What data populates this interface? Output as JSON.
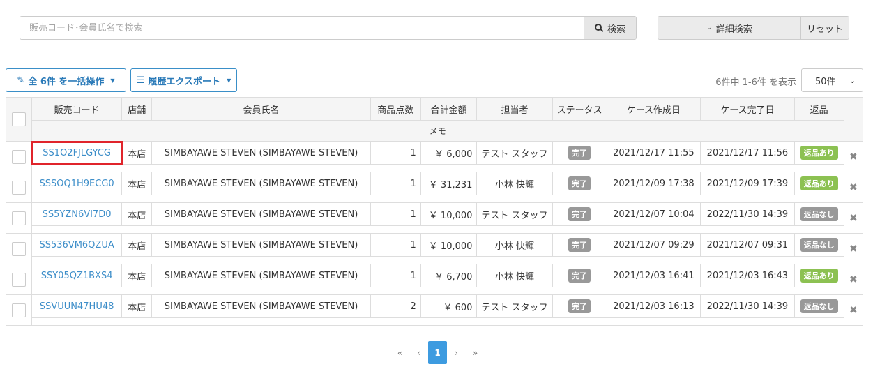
{
  "search": {
    "placeholder": "販売コード･会員氏名で検索",
    "button_label": "検索",
    "advanced_label": "詳細検索",
    "reset_label": "リセット"
  },
  "actions": {
    "bulk_label": "全 6件 を一括操作",
    "export_label": "履歴エクスポート"
  },
  "summary": {
    "count_text": "6件中 1-6件 を表示",
    "per_page": "50件"
  },
  "table": {
    "headers": {
      "code": "販売コード",
      "store": "店舗",
      "member": "会員氏名",
      "qty": "商品点数",
      "total": "合計金額",
      "staff": "担当者",
      "status": "ステータス",
      "created": "ケース作成日",
      "completed": "ケース完了日",
      "return": "返品",
      "memo": "メモ"
    },
    "rows": [
      {
        "code": "SS1O2FJLGYCG",
        "store": "本店",
        "member": "SIMBAYAWE STEVEN (SIMBAYAWE STEVEN)",
        "qty": "1",
        "total": "￥ 6,000",
        "staff": "テスト スタッフ",
        "status": "完了",
        "created": "2021/12/17 11:55",
        "completed": "2021/12/17 11:56",
        "return": "返品あり",
        "return_type": "yes"
      },
      {
        "code": "SSSOQ1H9ECG0",
        "store": "本店",
        "member": "SIMBAYAWE STEVEN (SIMBAYAWE STEVEN)",
        "qty": "1",
        "total": "￥ 31,231",
        "staff": "小林 快輝",
        "status": "完了",
        "created": "2021/12/09 17:38",
        "completed": "2021/12/09 17:39",
        "return": "返品あり",
        "return_type": "yes"
      },
      {
        "code": "SS5YZN6VI7D0",
        "store": "本店",
        "member": "SIMBAYAWE STEVEN (SIMBAYAWE STEVEN)",
        "qty": "1",
        "total": "￥ 10,000",
        "staff": "テスト スタッフ",
        "status": "完了",
        "created": "2021/12/07 10:04",
        "completed": "2022/11/30 14:39",
        "return": "返品なし",
        "return_type": "no"
      },
      {
        "code": "SS536VM6QZUA",
        "store": "本店",
        "member": "SIMBAYAWE STEVEN (SIMBAYAWE STEVEN)",
        "qty": "1",
        "total": "￥ 10,000",
        "staff": "小林 快輝",
        "status": "完了",
        "created": "2021/12/07 09:29",
        "completed": "2021/12/07 09:31",
        "return": "返品なし",
        "return_type": "no"
      },
      {
        "code": "SSY05QZ1BXS4",
        "store": "本店",
        "member": "SIMBAYAWE STEVEN (SIMBAYAWE STEVEN)",
        "qty": "1",
        "total": "￥ 6,700",
        "staff": "小林 快輝",
        "status": "完了",
        "created": "2021/12/03 16:41",
        "completed": "2021/12/03 16:43",
        "return": "返品あり",
        "return_type": "yes"
      },
      {
        "code": "SSVUUN47HU48",
        "store": "本店",
        "member": "SIMBAYAWE STEVEN (SIMBAYAWE STEVEN)",
        "qty": "2",
        "total": "￥ 600",
        "staff": "テスト スタッフ",
        "status": "完了",
        "created": "2021/12/03 16:13",
        "completed": "2022/11/30 14:39",
        "return": "返品なし",
        "return_type": "no"
      }
    ]
  },
  "pagination": {
    "first": "«",
    "prev": "‹",
    "current": "1",
    "next": "›",
    "last": "»"
  },
  "colors": {
    "link": "#3d8ec9",
    "return_yes": "#8cc152",
    "return_no": "#999999",
    "highlight": "#e0242b"
  }
}
